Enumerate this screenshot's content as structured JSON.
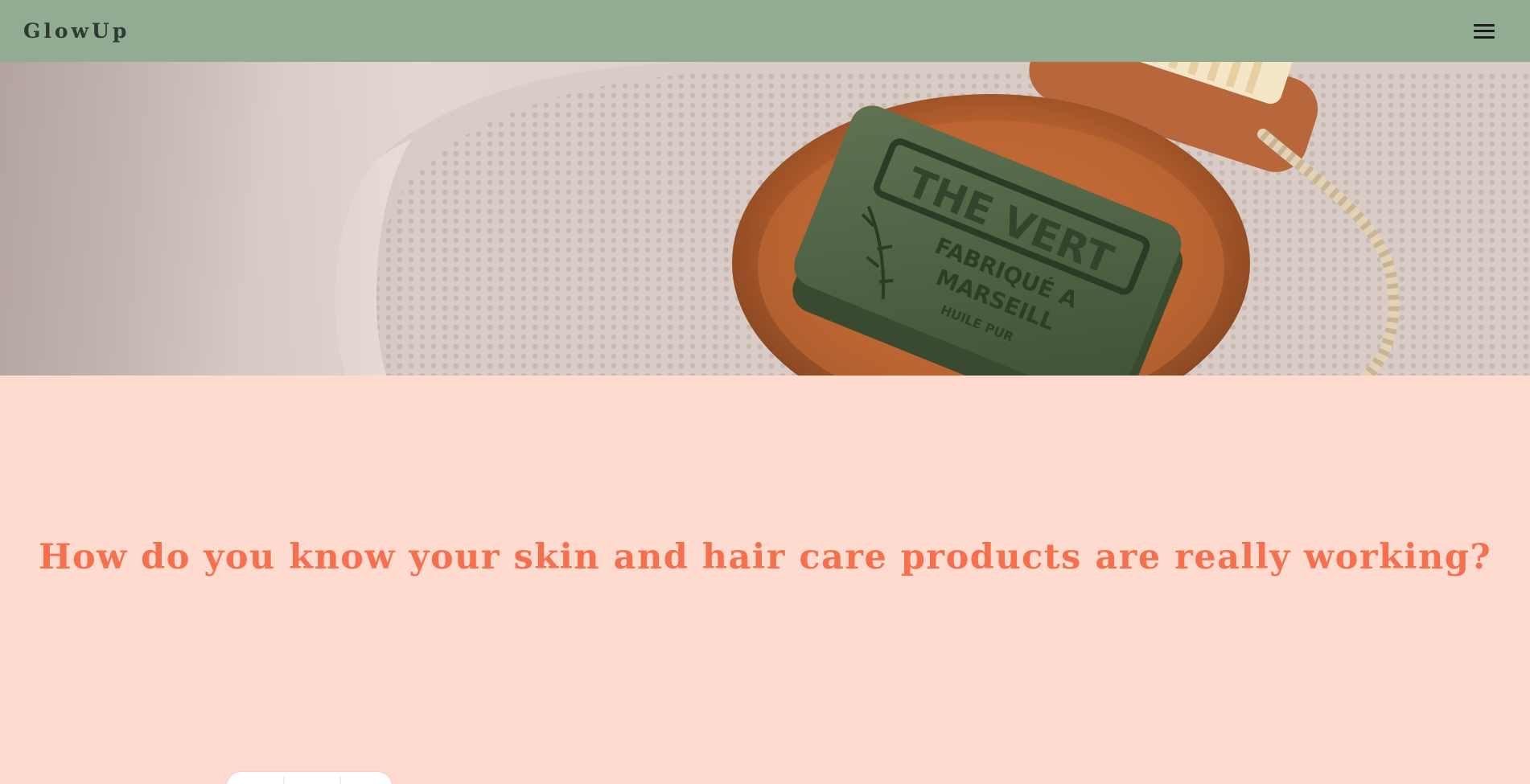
{
  "nav": {
    "brand": "GlowUp",
    "menu_icon": "hamburger-menu-icon"
  },
  "hero": {
    "image_text_line1": "THE VERT",
    "image_text_line2": "FABRIQUÉ A",
    "image_text_line3": "MARSEILL",
    "image_text_line4": "HUILE PUR"
  },
  "main": {
    "headline": "How do you know your skin and hair care products are really working?"
  },
  "colors": {
    "nav_bg": "#91ac93",
    "page_bg": "#ffdace",
    "headline": "#f4704f",
    "soap": "#4f6143",
    "dish": "#a0522d"
  }
}
